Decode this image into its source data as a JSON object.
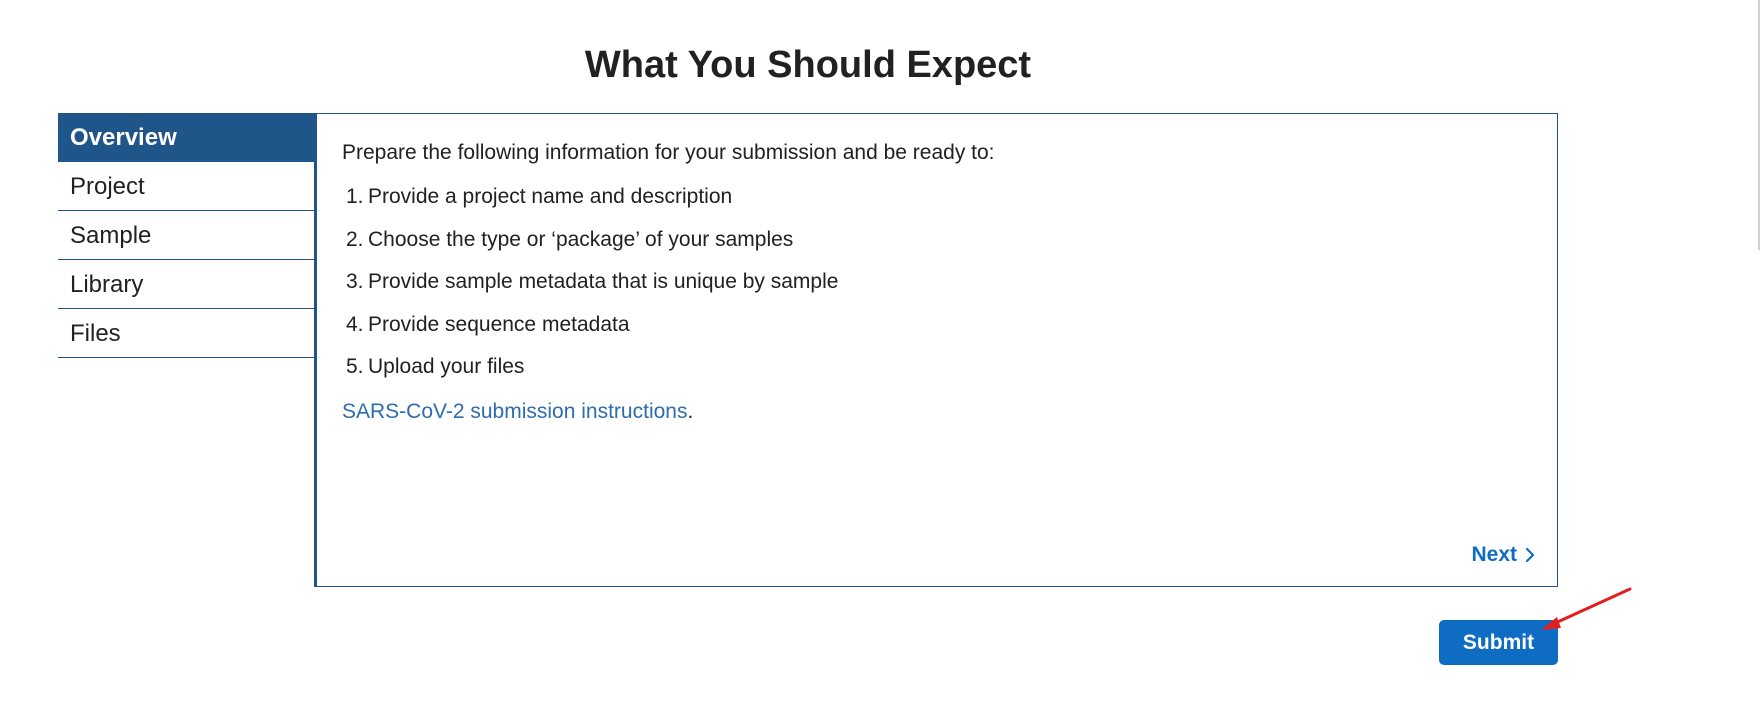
{
  "page": {
    "title": "What You Should Expect"
  },
  "tabs": [
    {
      "label": "Overview",
      "active": true
    },
    {
      "label": "Project",
      "active": false
    },
    {
      "label": "Sample",
      "active": false
    },
    {
      "label": "Library",
      "active": false
    },
    {
      "label": "Files",
      "active": false
    }
  ],
  "overview": {
    "intro": "Prepare the following information for your submission and be ready to:",
    "steps": [
      {
        "num": "1.",
        "text": "Provide a project name and description"
      },
      {
        "num": "2.",
        "text": "Choose the type or ‘package’ of your samples"
      },
      {
        "num": "3.",
        "text": "Provide sample metadata that is unique by sample"
      },
      {
        "num": "4.",
        "text": "Provide sequence metadata"
      },
      {
        "num": "5.",
        "text": "Upload your files"
      }
    ],
    "link_text": "SARS-CoV-2 submission instructions",
    "link_suffix": ".",
    "next_label": "Next"
  },
  "actions": {
    "submit_label": "Submit"
  },
  "colors": {
    "tab_active_bg": "#20558a",
    "border": "#20558a",
    "link": "#2e6cad",
    "button": "#0e6cc2",
    "annotation_arrow": "#e02020"
  },
  "icons": {
    "next": "chevron-right-icon",
    "annotation": "red-arrow-icon"
  }
}
